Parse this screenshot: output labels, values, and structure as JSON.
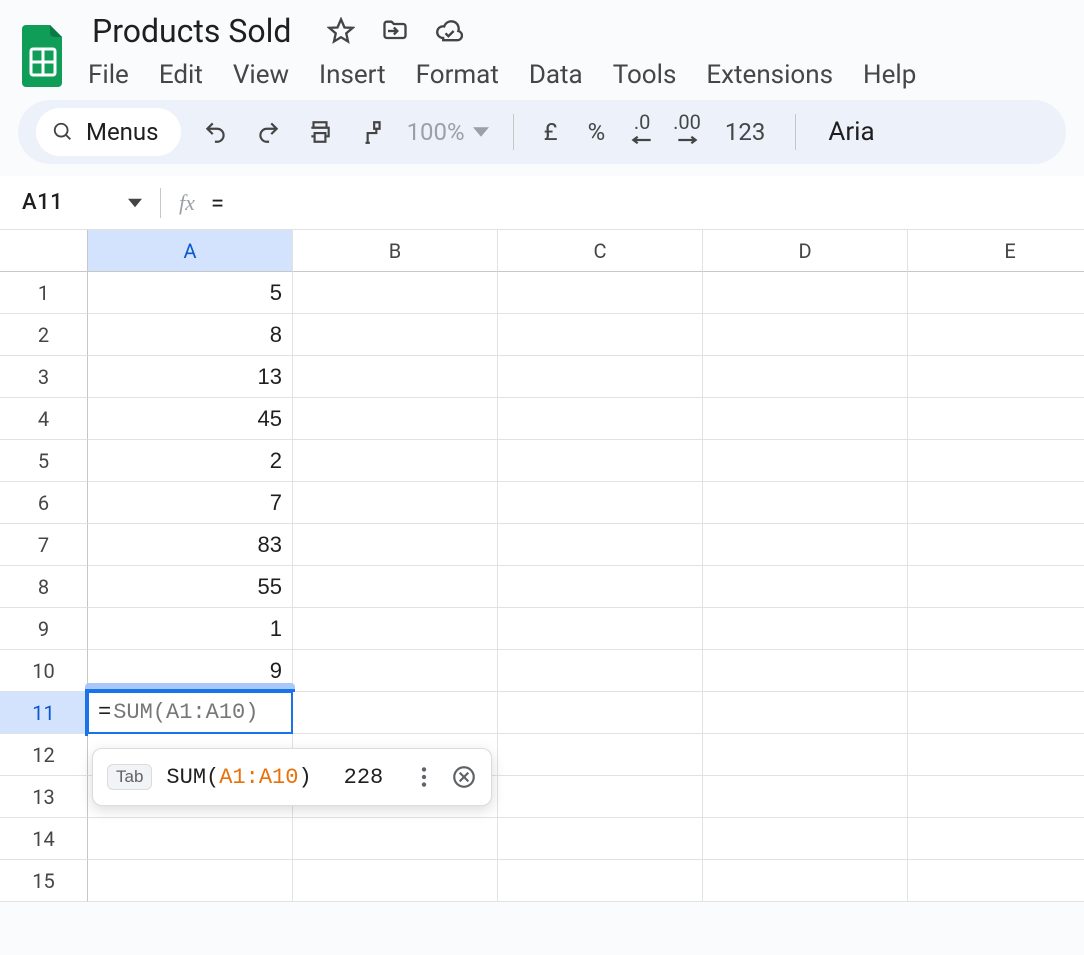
{
  "doc": {
    "title": "Products Sold"
  },
  "menus": {
    "file": "File",
    "edit": "Edit",
    "view": "View",
    "insert": "Insert",
    "format": "Format",
    "data": "Data",
    "tools": "Tools",
    "extensions": "Extensions",
    "help": "Help"
  },
  "toolbar": {
    "menus_label": "Menus",
    "zoom": "100%",
    "currency": "£",
    "percent": "%",
    "dec_dec": ".0",
    "inc_dec": ".00",
    "number_format": "123",
    "font": "Aria"
  },
  "namebox": {
    "ref": "A11"
  },
  "formula_bar": {
    "value": "="
  },
  "columns": [
    "A",
    "B",
    "C",
    "D",
    "E"
  ],
  "selected_column_index": 0,
  "selected_row_ref": 11,
  "rows": [
    {
      "ref": 1,
      "values": [
        "5",
        "",
        "",
        "",
        ""
      ]
    },
    {
      "ref": 2,
      "values": [
        "8",
        "",
        "",
        "",
        ""
      ]
    },
    {
      "ref": 3,
      "values": [
        "13",
        "",
        "",
        "",
        ""
      ]
    },
    {
      "ref": 4,
      "values": [
        "45",
        "",
        "",
        "",
        ""
      ]
    },
    {
      "ref": 5,
      "values": [
        "2",
        "",
        "",
        "",
        ""
      ]
    },
    {
      "ref": 6,
      "values": [
        "7",
        "",
        "",
        "",
        ""
      ]
    },
    {
      "ref": 7,
      "values": [
        "83",
        "",
        "",
        "",
        ""
      ]
    },
    {
      "ref": 8,
      "values": [
        "55",
        "",
        "",
        "",
        ""
      ]
    },
    {
      "ref": 9,
      "values": [
        "1",
        "",
        "",
        "",
        ""
      ]
    },
    {
      "ref": 10,
      "values": [
        "9",
        "",
        "",
        "",
        ""
      ]
    },
    {
      "ref": 11,
      "values": [
        "",
        "",
        "",
        "",
        ""
      ]
    },
    {
      "ref": 12,
      "values": [
        "",
        "",
        "",
        "",
        ""
      ]
    },
    {
      "ref": 13,
      "values": [
        "",
        "",
        "",
        "",
        ""
      ]
    },
    {
      "ref": 14,
      "values": [
        "",
        "",
        "",
        "",
        ""
      ]
    },
    {
      "ref": 15,
      "values": [
        "",
        "",
        "",
        "",
        ""
      ]
    }
  ],
  "edit": {
    "cell_ref": "A11",
    "typed": "=",
    "ghost": "SUM(A1:A10)"
  },
  "suggestion": {
    "key_hint": "Tab",
    "fn": "SUM",
    "open": "(",
    "range": "A1:A10",
    "close": ")",
    "result": "228"
  }
}
